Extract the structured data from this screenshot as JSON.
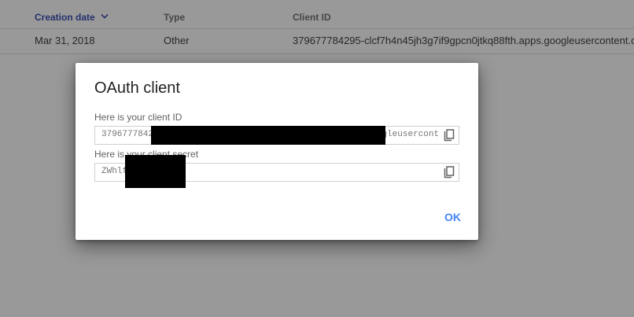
{
  "table": {
    "headers": {
      "creation_date": "Creation date",
      "type": "Type",
      "client_id": "Client ID"
    },
    "rows": [
      {
        "date": "Mar 31, 2018",
        "type": "Other",
        "client_id": "379677784295-clcf7h4n45jh3g7if9gpcn0jtkq88fth.apps.googleusercontent.com"
      }
    ]
  },
  "dialog": {
    "title": "OAuth client",
    "client_id_label": "Here is your client ID",
    "client_id_value": "379677784295-clcf7h4n45jh3g7if9gpcn0jtkq88fth.apps.googleusercontent.com",
    "client_secret_label": "Here is your client secret",
    "client_secret_value": "ZWhlf          7tmZIxs",
    "ok_label": "OK"
  },
  "colors": {
    "accent": "#4285f4",
    "sorted_header": "#3f51b5",
    "scrim": "rgba(0,0,0,0.40)"
  },
  "icons": {
    "sort": "arrow-down-icon",
    "copy": "copy-icon"
  }
}
